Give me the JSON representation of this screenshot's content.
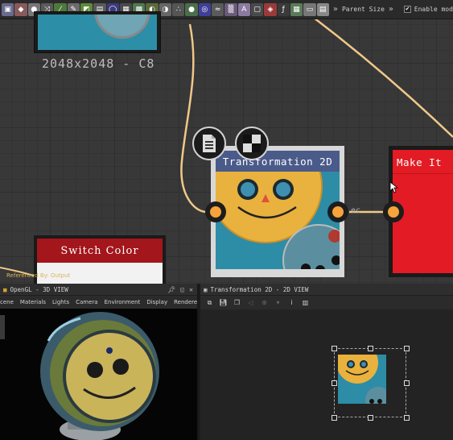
{
  "graph": {
    "resolution_label": "2048x2048 - C8",
    "transformation_node": {
      "title": "Transformation 2D"
    },
    "switch_node": {
      "title": "Switch Color"
    },
    "make_node": {
      "title": "Make It"
    },
    "wire_label": "ec",
    "referenced_label": "Referenced By: Output"
  },
  "toolbar": {
    "parent_size": "Parent Size",
    "enable_label": "Enable mod"
  },
  "panel_3d": {
    "title": "OpenGL - 3D VIEW",
    "menu": [
      "cene",
      "Materials",
      "Lights",
      "Camera",
      "Environment",
      "Display",
      "Renderer"
    ]
  },
  "panel_2d": {
    "title": "Transformation 2D - 2D VIEW"
  },
  "colors": {
    "accent_port": "#f5a33a",
    "switch_header": "#a3161c",
    "make_node": "#e31b24",
    "xform_header": "#4a5b8a"
  }
}
